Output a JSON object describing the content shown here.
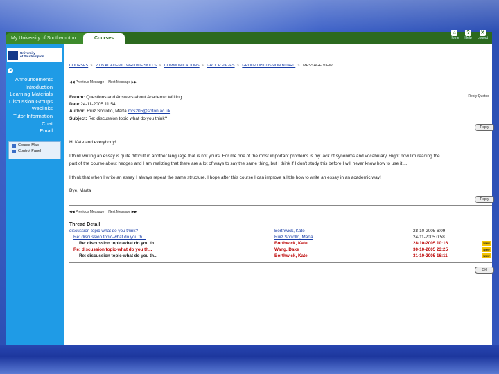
{
  "header": {
    "tab_home": "My University of Southampton",
    "tab_courses": "Courses",
    "links": [
      {
        "label": "Home",
        "icon": "home-icon"
      },
      {
        "label": "Help",
        "icon": "help-icon"
      },
      {
        "label": "Logout",
        "icon": "logout-icon"
      }
    ]
  },
  "sidebar": {
    "logo_line1": "University",
    "logo_line2": "of Southampton",
    "menu": [
      "Announcements",
      "Introduction",
      "Learning Materials",
      "Discussion Groups",
      "Weblinks",
      "Tutor Information",
      "Chat",
      "Email"
    ],
    "tools": [
      "Course Map",
      "Control Panel"
    ]
  },
  "breadcrumb": [
    "COURSES",
    "2005 ACADEMIC WRITING SKILLS",
    "COMMUNICATIONS",
    "GROUP PAGES",
    "GROUP DISCUSSION BOARD",
    "MESSAGE VIEW"
  ],
  "nav": {
    "prev": "Previous Message",
    "next": "Next Message"
  },
  "message": {
    "forum_label": "Forum:",
    "forum_value": "Questions and Answers about Academic Writing",
    "date_label": "Date:",
    "date_value": "24-11-2005 11:54",
    "author_label": "Author:",
    "author_name": "Ruiz Sorrollo, Marta",
    "author_email": "mrs205@soton.ac.uk",
    "subject_label": "Subject:",
    "subject_value": "Re: discussion topic what do you think?",
    "reply_top_label": "Reply Quoted",
    "reply_button": "Reply",
    "body_greeting": "Hi Kate and everybody!",
    "body_p1a": "I think writing an essay is quite difficult in another language that is not yours. For me one of the most important problems is my lack of synonims and vocabulary. Right now I'm reading the",
    "body_p1b": "part of the course about hedges and I am realizing that there are a lot of ways to say the same thing, but I think if I don't study this before I will never know how to use it ...",
    "body_p2": "I think that when I write an essay I always repeat the same structure. I hope after this course I can improve a little how to write an essay in an academic way!",
    "body_sign": "Bye, Marta"
  },
  "thread": {
    "title": "Thread Detail",
    "rows": [
      {
        "subject": "discussion topic-what do you think?",
        "author": "Borthwick, Kate",
        "date": "28-10-2005 6:09",
        "new": "",
        "style": "link"
      },
      {
        "subject": "Re: discussion topic-what do you th...",
        "author": "Ruiz Sorrollo, Marta",
        "date": "24-11-2005 0:58",
        "new": "",
        "style": "link"
      },
      {
        "subject": "Re: discussion topic-what do you th...",
        "author": "Borthwick, Kate",
        "date": "28-10-2005 10:16",
        "new": "New",
        "style": "bold"
      },
      {
        "subject": "Re: discussion topic-what do you th...",
        "author": "Wang, Dake",
        "date": "30-10-2005 23:25",
        "new": "New",
        "style": "bold"
      },
      {
        "subject": "Re: discussion topic-what do you th...",
        "author": "Borthwick, Kate",
        "date": "31-10-2005 16:11",
        "new": "New",
        "style": "bold"
      }
    ],
    "ok_button": "OK"
  }
}
